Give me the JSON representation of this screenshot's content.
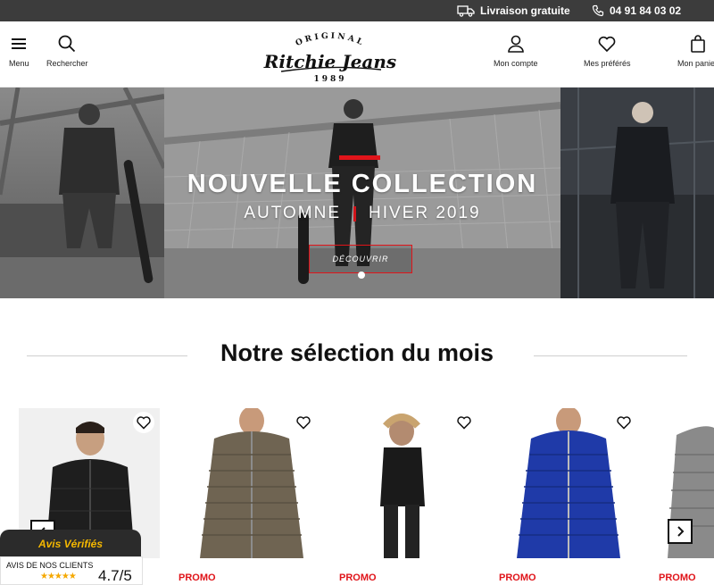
{
  "topbar": {
    "delivery_label": "Livraison gratuite",
    "phone": "04 91 84 03 02",
    "delivery_icon": "truck-icon",
    "phone_icon": "phone-icon"
  },
  "header": {
    "menu_label": "Menu",
    "search_label": "Rechercher",
    "account_label": "Mon compte",
    "favorites_label": "Mes préférés",
    "cart_label": "Mon panier",
    "logo": {
      "top": "ORIGINAL",
      "main": "Ritchie Jeans",
      "year": "1989"
    }
  },
  "hero": {
    "title": "NOUVELLE COLLECTION",
    "subtitle_left": "AUTOMNE",
    "subtitle_right": "HIVER 2019",
    "cta_label": "DÉCOUVRIR",
    "accent_color": "#e0141a"
  },
  "selection": {
    "title": "Notre sélection du mois",
    "products": [
      {
        "badge": "",
        "name": "black hooded puffer jacket",
        "color": "#1e1e1e"
      },
      {
        "badge": "PROMO",
        "name": "khaki quilted puffer jacket",
        "color": "#6f6452"
      },
      {
        "badge": "PROMO",
        "name": "black fur hood jacket",
        "color": "#1a1a1a"
      },
      {
        "badge": "PROMO",
        "name": "royal blue hooded puffer jacket",
        "color": "#1f3aa8"
      },
      {
        "badge": "PROMO",
        "name": "grey puffer jacket",
        "color": "#8a8a8a"
      }
    ]
  },
  "reviews": {
    "brand": "Avis Vérifiés",
    "caption": "AVIS DE NOS CLIENTS",
    "stars": "★★★★★",
    "score": "4.7/5"
  }
}
